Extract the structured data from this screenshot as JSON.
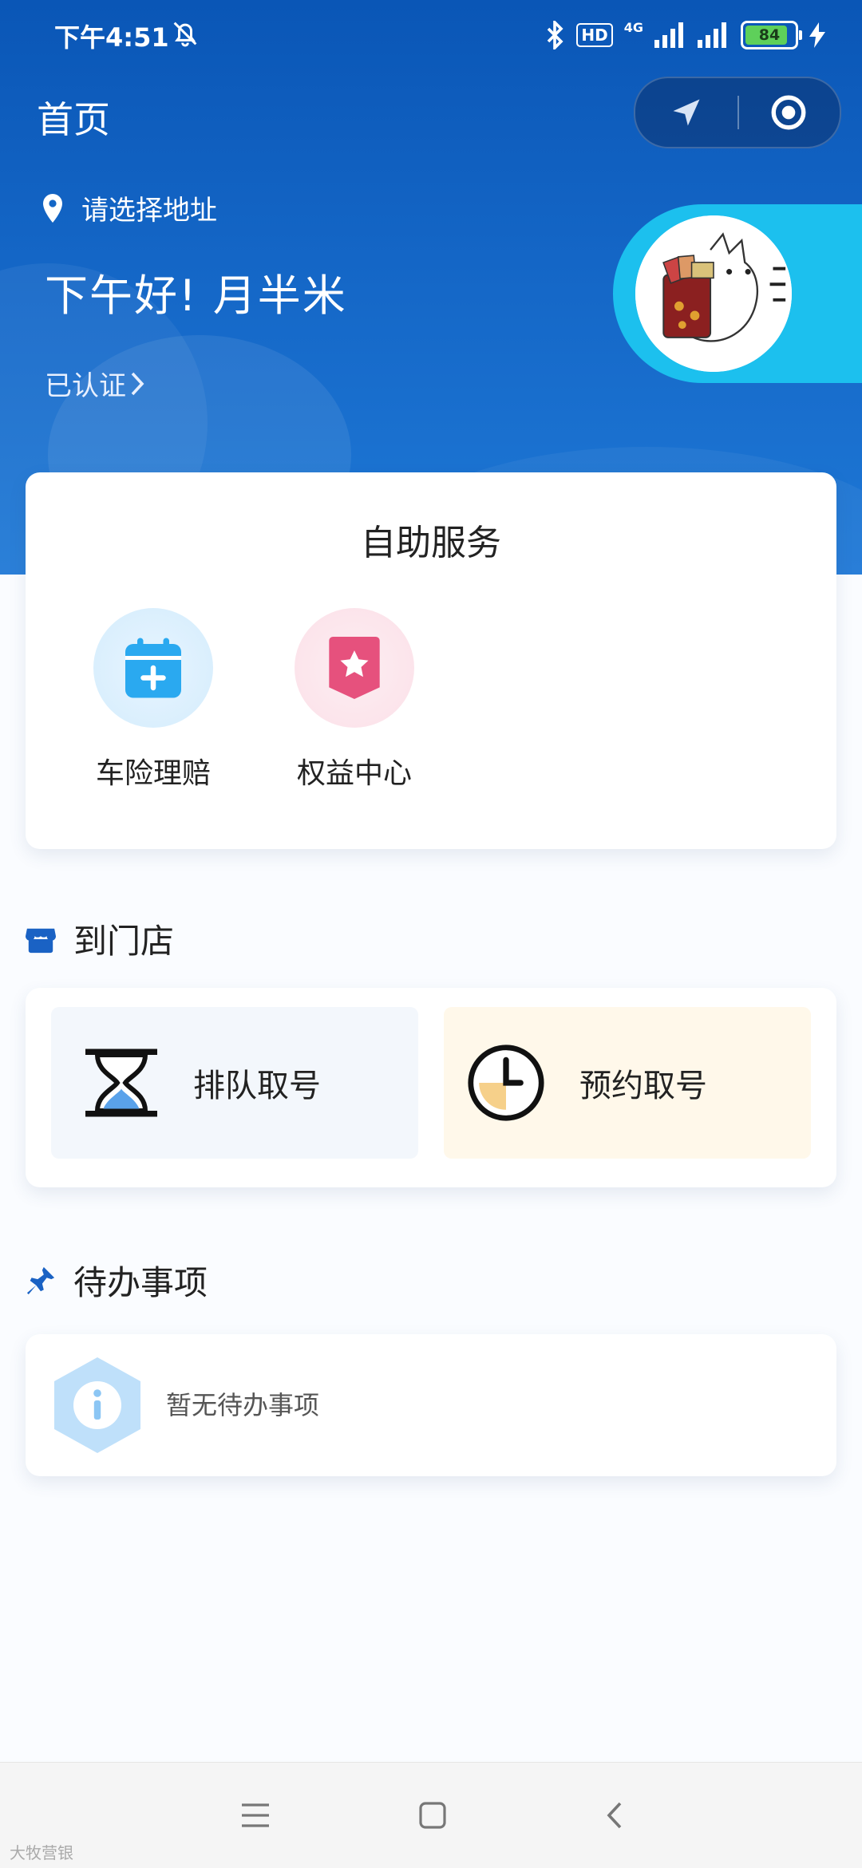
{
  "status_bar": {
    "time": "下午4:51",
    "hd": "HD",
    "net": "4G",
    "battery": "84"
  },
  "header": {
    "title": "首页",
    "location_button": "navigation-arrow",
    "record_button": "target-circle"
  },
  "user": {
    "address_placeholder": "请选择地址",
    "greeting": "下午好! 月半米",
    "verified": "已认证"
  },
  "self_service": {
    "title": "自助服务",
    "items": [
      {
        "label": "车险理赔",
        "icon": "calendar-plus-icon",
        "color": "#2aa9f0"
      },
      {
        "label": "权益中心",
        "icon": "star-badge-icon",
        "color": "#e6517d"
      }
    ]
  },
  "store": {
    "title": "到门店",
    "tiles": [
      {
        "label": "排队取号",
        "icon": "hourglass-icon",
        "bg": "#f3f7fc"
      },
      {
        "label": "预约取号",
        "icon": "clock-icon",
        "bg": "#fff8ea"
      }
    ]
  },
  "todo": {
    "title": "待办事项",
    "empty_text": "暂无待办事项"
  },
  "watermark": "大牧营银",
  "colors": {
    "primary": "#1466c6",
    "accent": "#1cc0ee"
  }
}
